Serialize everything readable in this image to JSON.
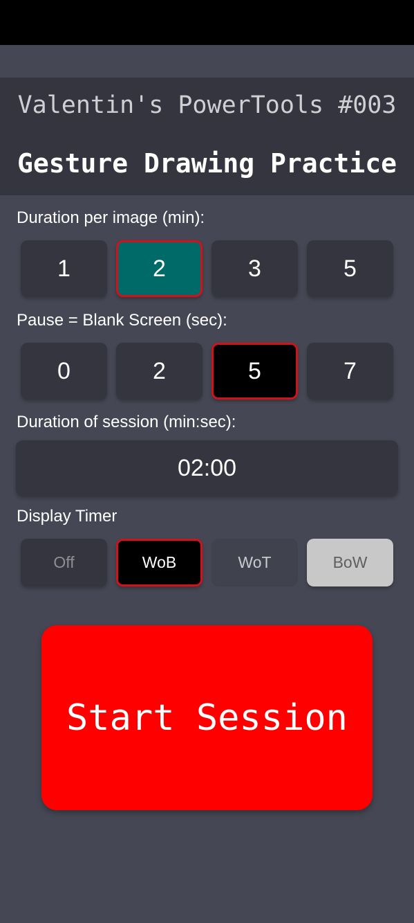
{
  "header": {
    "app_title": "Valentin's PowerTools #003",
    "page_title": "Gesture Drawing Practice"
  },
  "duration_per_image": {
    "label": "Duration per image (min):",
    "options": [
      "1",
      "2",
      "3",
      "5"
    ],
    "selected": "2"
  },
  "pause": {
    "label": "Pause = Blank Screen (sec):",
    "options": [
      "0",
      "2",
      "5",
      "7"
    ],
    "selected": "5"
  },
  "session_duration": {
    "label": "Duration of session (min:sec):",
    "value": "02:00"
  },
  "display_timer": {
    "label": "Display Timer",
    "options": [
      "Off",
      "WoB",
      "WoT",
      "BoW"
    ],
    "selected": "WoB"
  },
  "start_button": {
    "label": "Start Session"
  },
  "colors": {
    "background": "#454754",
    "header_band": "#34353f",
    "button": "#34353f",
    "selected_teal": "#006a68",
    "selected_border": "#d0121a",
    "start_button": "#fe0000"
  }
}
